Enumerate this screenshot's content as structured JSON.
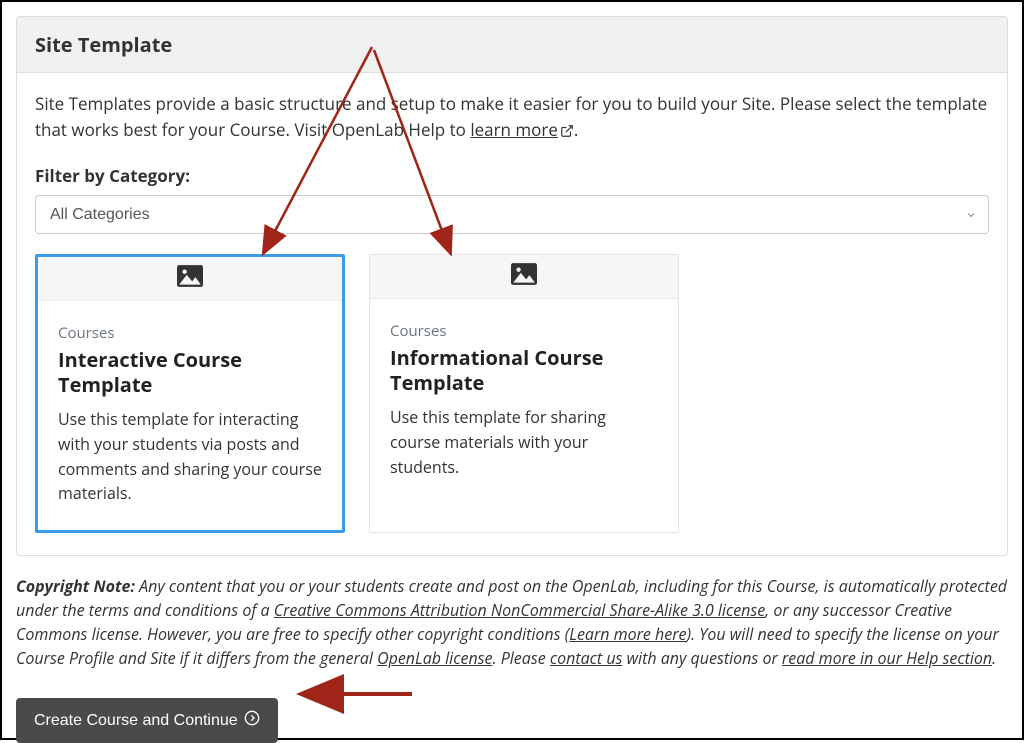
{
  "panel": {
    "title": "Site Template",
    "intro_a": "Site Templates provide a basic structure and setup to make it easier for you to build your Site. Please select the template that works best for your Course. Visit OpenLab Help to ",
    "intro_link": "learn more"
  },
  "filter": {
    "label": "Filter by Category:",
    "selected": "All Categories"
  },
  "cards": [
    {
      "category": "Courses",
      "title": "Interactive Course Template",
      "desc": "Use this template for interacting with your students via posts and comments and sharing your course materials."
    },
    {
      "category": "Courses",
      "title": "Informational Course Template",
      "desc": "Use this template for sharing course materials with your students."
    }
  ],
  "copyright": {
    "lead": "Copyright Note:",
    "t1": " Any content that you or your students create and post on the OpenLab, including for this Course, is automatically protected under the terms and conditions of a ",
    "link1": "Creative Commons Attribution NonCommercial Share-Alike 3.0 license",
    "t2": ", or any successor Creative Commons license. However, you are free to specify other copyright conditions (",
    "link2": "Learn more here",
    "t3": "). You will need to specify the license on your Course Profile and Site if it differs from the general ",
    "link3": "OpenLab license",
    "t4": ". Please ",
    "link4": "contact us",
    "t5": " with any questions or ",
    "link5": "read more in our Help section",
    "t6": "."
  },
  "buttons": {
    "submit": "Create Course and Continue"
  },
  "colors": {
    "accent_select": "#3a9be8",
    "anno_red": "#a02417",
    "btn_bg": "#4a4a4a"
  }
}
